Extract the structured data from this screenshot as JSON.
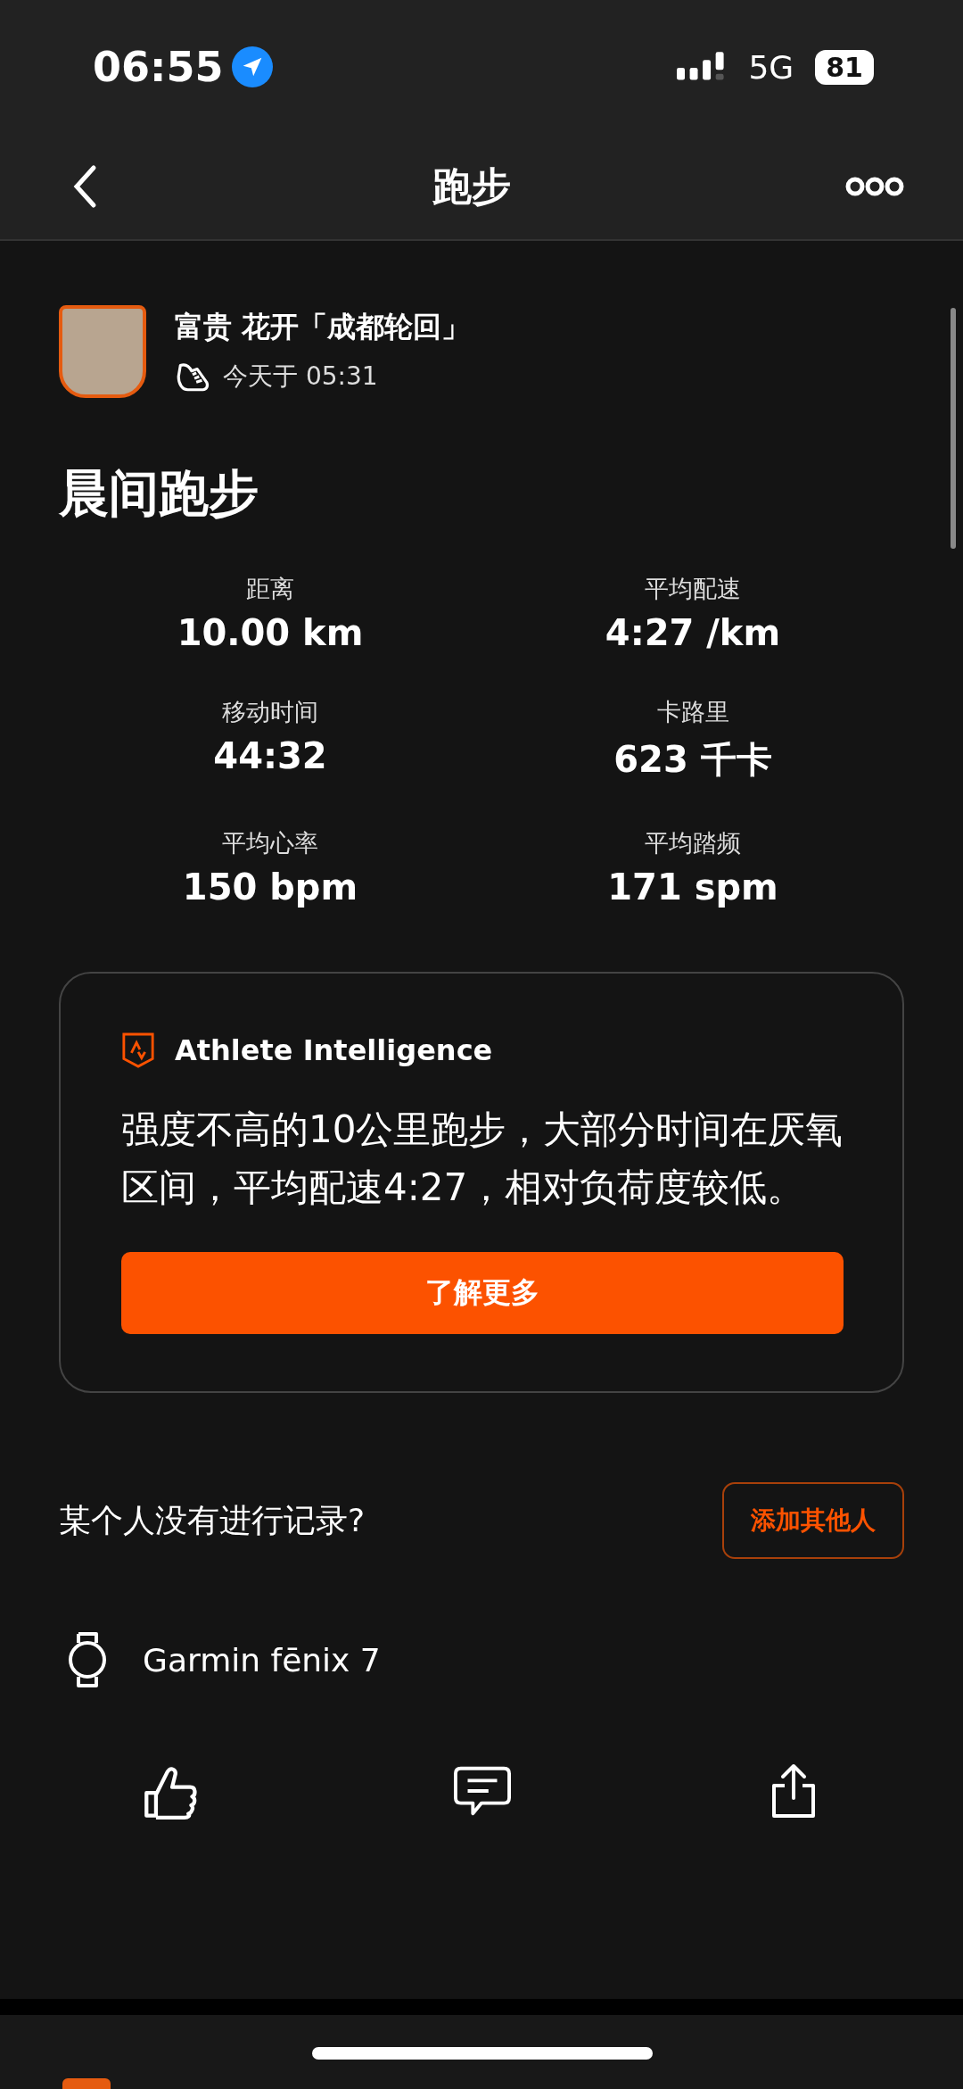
{
  "status_bar": {
    "time": "06:55",
    "network": "5G",
    "battery": "81"
  },
  "nav": {
    "title": "跑步"
  },
  "athlete": {
    "name": "富贵 花开「成都轮回」",
    "time": "今天于 05:31"
  },
  "activity": {
    "title": "晨间跑步"
  },
  "stats": [
    {
      "label": "距离",
      "value": "10.00 km"
    },
    {
      "label": "平均配速",
      "value": "4:27 /km"
    },
    {
      "label": "移动时间",
      "value": "44:32"
    },
    {
      "label": "卡路里",
      "value": "623 千卡"
    },
    {
      "label": "平均心率",
      "value": "150 bpm"
    },
    {
      "label": "平均踏频",
      "value": "171 spm"
    }
  ],
  "insight": {
    "title": "Athlete Intelligence",
    "summary": "强度不高的10公里跑步，大部分时间在厌氧区间，平均配速4:27，相对负荷度较低。",
    "button": "了解更多"
  },
  "add_others": {
    "prompt": "某个人没有进行记录?",
    "button": "添加其他人"
  },
  "device": {
    "name": "Garmin fēnix 7"
  }
}
